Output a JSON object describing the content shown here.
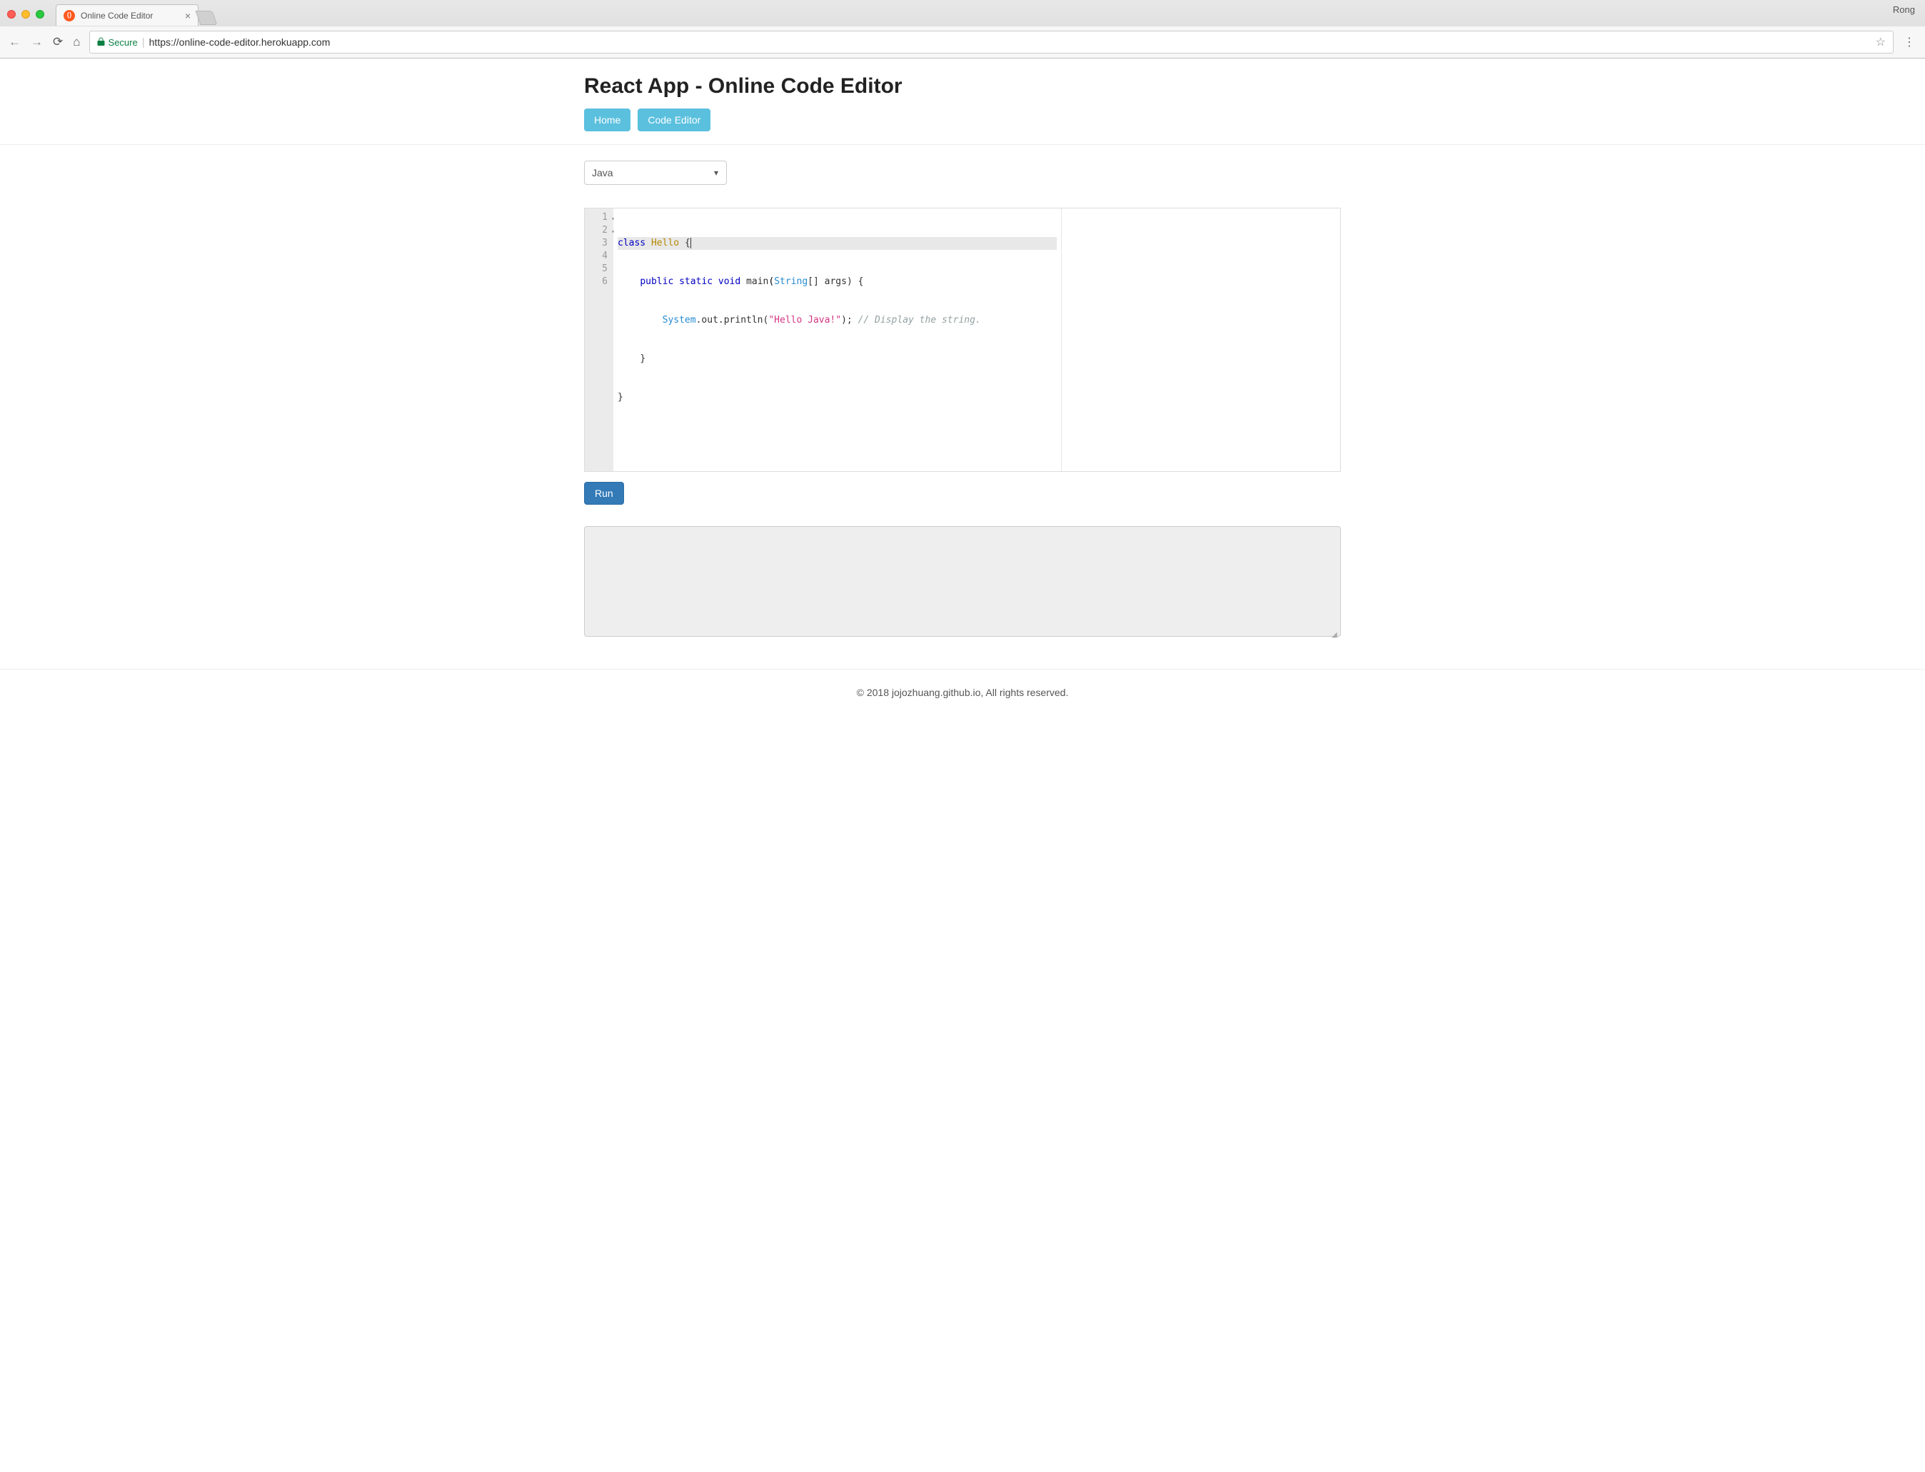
{
  "browser": {
    "tab_title": "Online Code Editor",
    "profile": "Rong",
    "secure_label": "Secure",
    "url": "https://online-code-editor.herokuapp.com"
  },
  "header": {
    "title": "React App - Online Code Editor",
    "nav": {
      "home": "Home",
      "code_editor": "Code Editor"
    }
  },
  "editor": {
    "language_selected": "Java",
    "line_numbers": [
      "1",
      "2",
      "3",
      "4",
      "5",
      "6"
    ],
    "code": {
      "l1": {
        "kw_class": "class",
        "cls": "Hello",
        "brace": "{"
      },
      "l2": {
        "kw_public": "public",
        "kw_static": "static",
        "kw_void": "void",
        "fn": "main",
        "type": "String",
        "rest": "[] args) {"
      },
      "l3": {
        "sys": "System",
        "rest1": ".out.println(",
        "str": "\"Hello Java!\"",
        "rest2": "); ",
        "comment": "// Display the string."
      },
      "l4": {
        "brace": "}"
      },
      "l5": {
        "brace": "}"
      }
    },
    "run_label": "Run",
    "output_value": ""
  },
  "footer": {
    "text": "© 2018 jojozhuang.github.io, All rights reserved."
  }
}
